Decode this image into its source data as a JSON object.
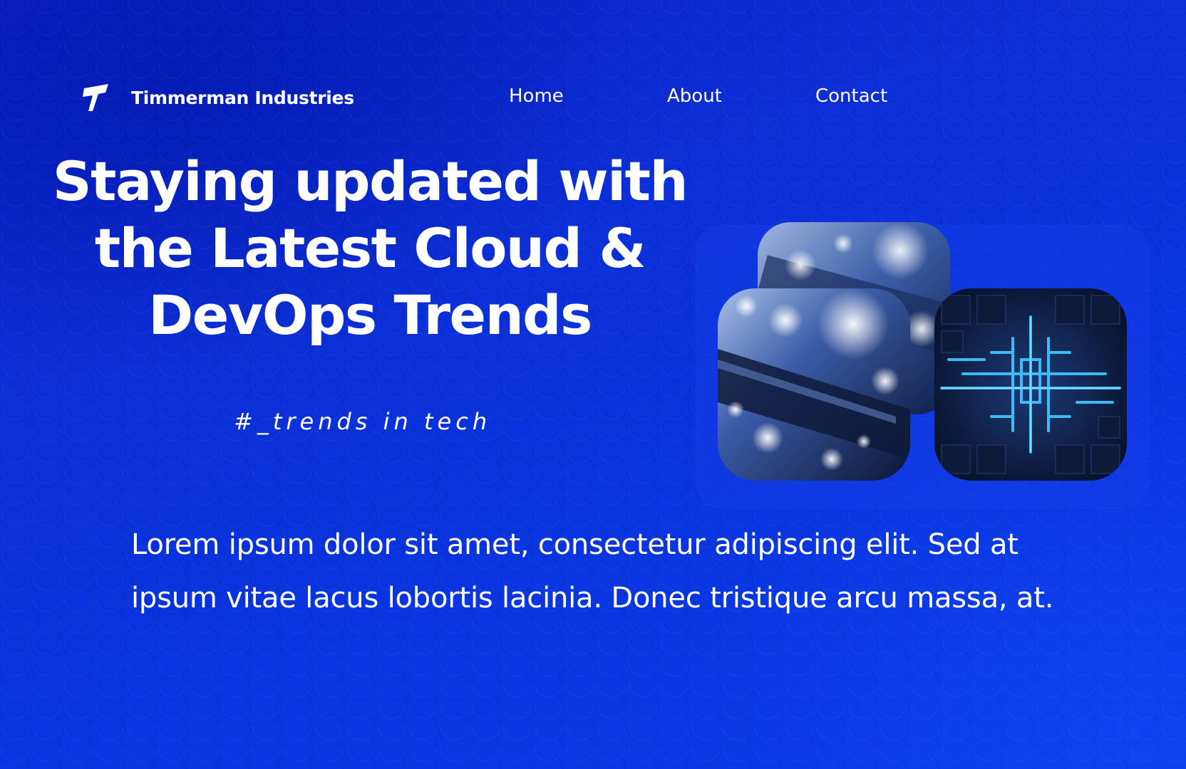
{
  "brand": {
    "name": "Timmerman Industries",
    "logo_icon": "t-logo-icon"
  },
  "nav": {
    "items": [
      {
        "label": "Home"
      },
      {
        "label": "About"
      },
      {
        "label": "Contact"
      }
    ]
  },
  "hero": {
    "title": "Staying updated with the Latest Cloud & DevOps Trends",
    "tagline": "#_trends in tech",
    "body": "Lorem ipsum dolor sit amet, consectetur adipiscing elit. Sed at ipsum vitae lacus lobortis lacinia. Donec tristique arcu massa, at."
  },
  "media": {
    "images": [
      {
        "name": "circuit-board-image-back"
      },
      {
        "name": "circuit-board-image"
      },
      {
        "name": "glowing-circuit-maze-image"
      }
    ]
  },
  "colors": {
    "background": "#0b2fd6",
    "text": "#ffffff",
    "panel": "#1a3fe6",
    "accent_glow": "#3fb8ff"
  }
}
